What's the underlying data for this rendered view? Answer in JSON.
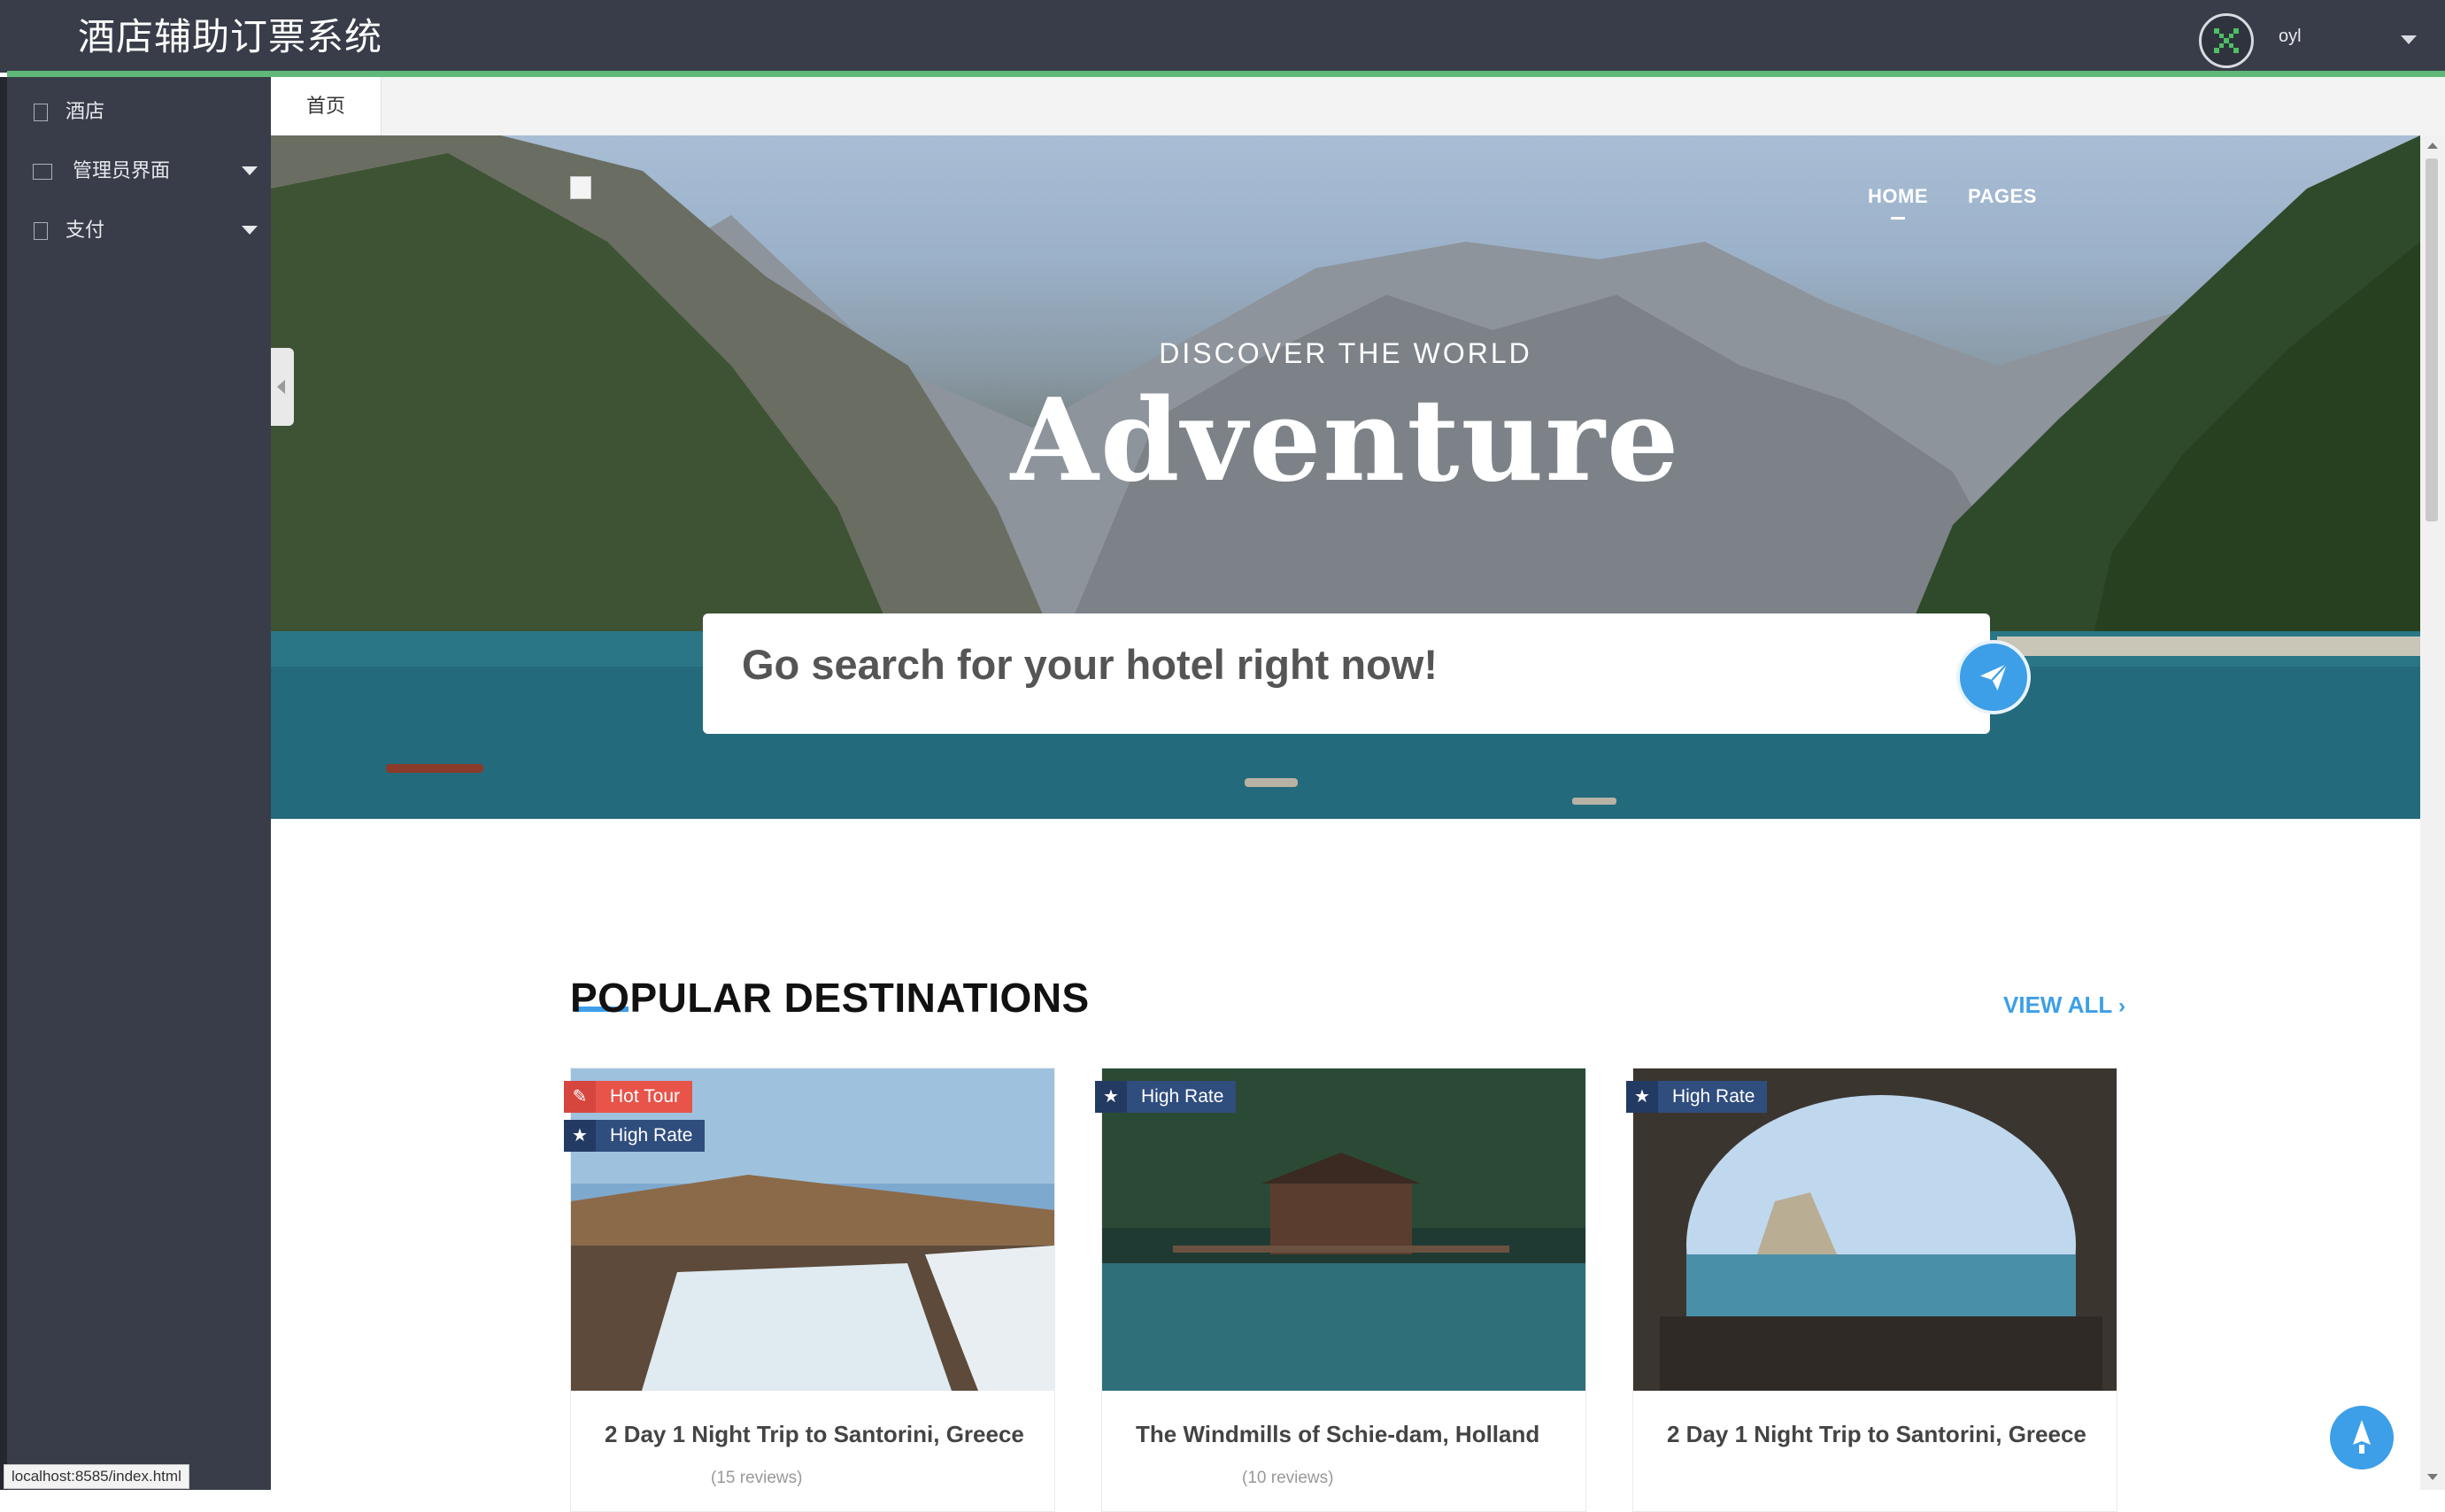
{
  "app": {
    "title": "酒店辅助订票系统",
    "user": "oyl"
  },
  "sidebar": {
    "items": [
      {
        "label": "酒店",
        "icon": "document-icon"
      },
      {
        "label": "管理员界面",
        "icon": "building-icon"
      },
      {
        "label": "支付",
        "icon": "document-icon"
      }
    ]
  },
  "tabs": [
    {
      "label": "首页"
    }
  ],
  "hero": {
    "nav": [
      {
        "label": "HOME"
      },
      {
        "label": "PAGES"
      }
    ],
    "kicker": "DISCOVER THE WORLD",
    "headline": "Adventure",
    "search_placeholder": "Go search for your hotel right now!"
  },
  "section": {
    "title": "POPULAR DESTINATIONS",
    "view_all": "VIEW ALL"
  },
  "cards": [
    {
      "title": "2 Day 1 Night Trip to Santorini, Greece",
      "reviews": "(15 reviews)",
      "badges": [
        "Hot Tour",
        "High Rate"
      ]
    },
    {
      "title": "The Windmills of Schie-dam, Holland",
      "reviews": "(10 reviews)",
      "badges": [
        "High Rate"
      ]
    },
    {
      "title": "2 Day 1 Night Trip to Santorini, Greece",
      "reviews": "",
      "badges": [
        "High Rate"
      ]
    }
  ],
  "statusbar": {
    "url": "localhost:8585/index.html"
  },
  "colors": {
    "topbar": "#393d49",
    "accent_green": "#5fb878",
    "primary_blue": "#3c9fe8",
    "badge_hot": "#e8534a",
    "badge_rate": "#2f4d7d"
  }
}
